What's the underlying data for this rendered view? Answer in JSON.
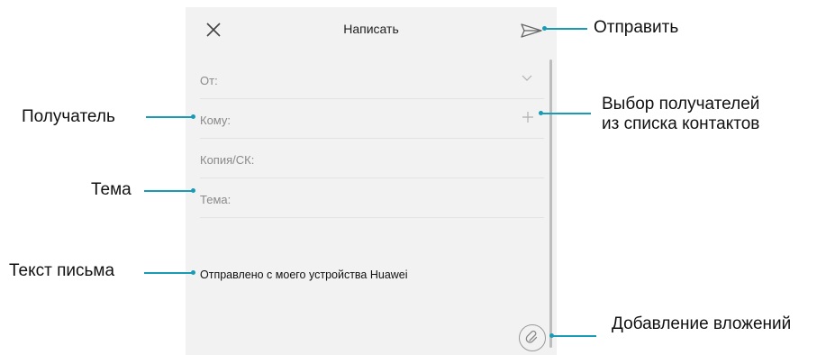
{
  "compose": {
    "title": "Написать",
    "fields": {
      "from": "От:",
      "to": "Кому:",
      "cc": "Копия/СК:",
      "subject": "Тема:"
    },
    "body": "Отправлено с моего устройства Huawei"
  },
  "annotations": {
    "send": "Отправить",
    "recipient": "Получатель",
    "choose_line1": "Выбор получателей",
    "choose_line2": "из списка контактов",
    "subject": "Тема",
    "body": "Текст письма",
    "attach": "Добавление вложений"
  },
  "icons": {
    "close": "close-icon",
    "send": "send-icon",
    "expand": "chevron-down-icon",
    "add": "plus-icon",
    "attach": "paperclip-icon"
  },
  "colors": {
    "annotation_line": "#1a9bb5",
    "screen_bg": "#f2f2f2"
  }
}
